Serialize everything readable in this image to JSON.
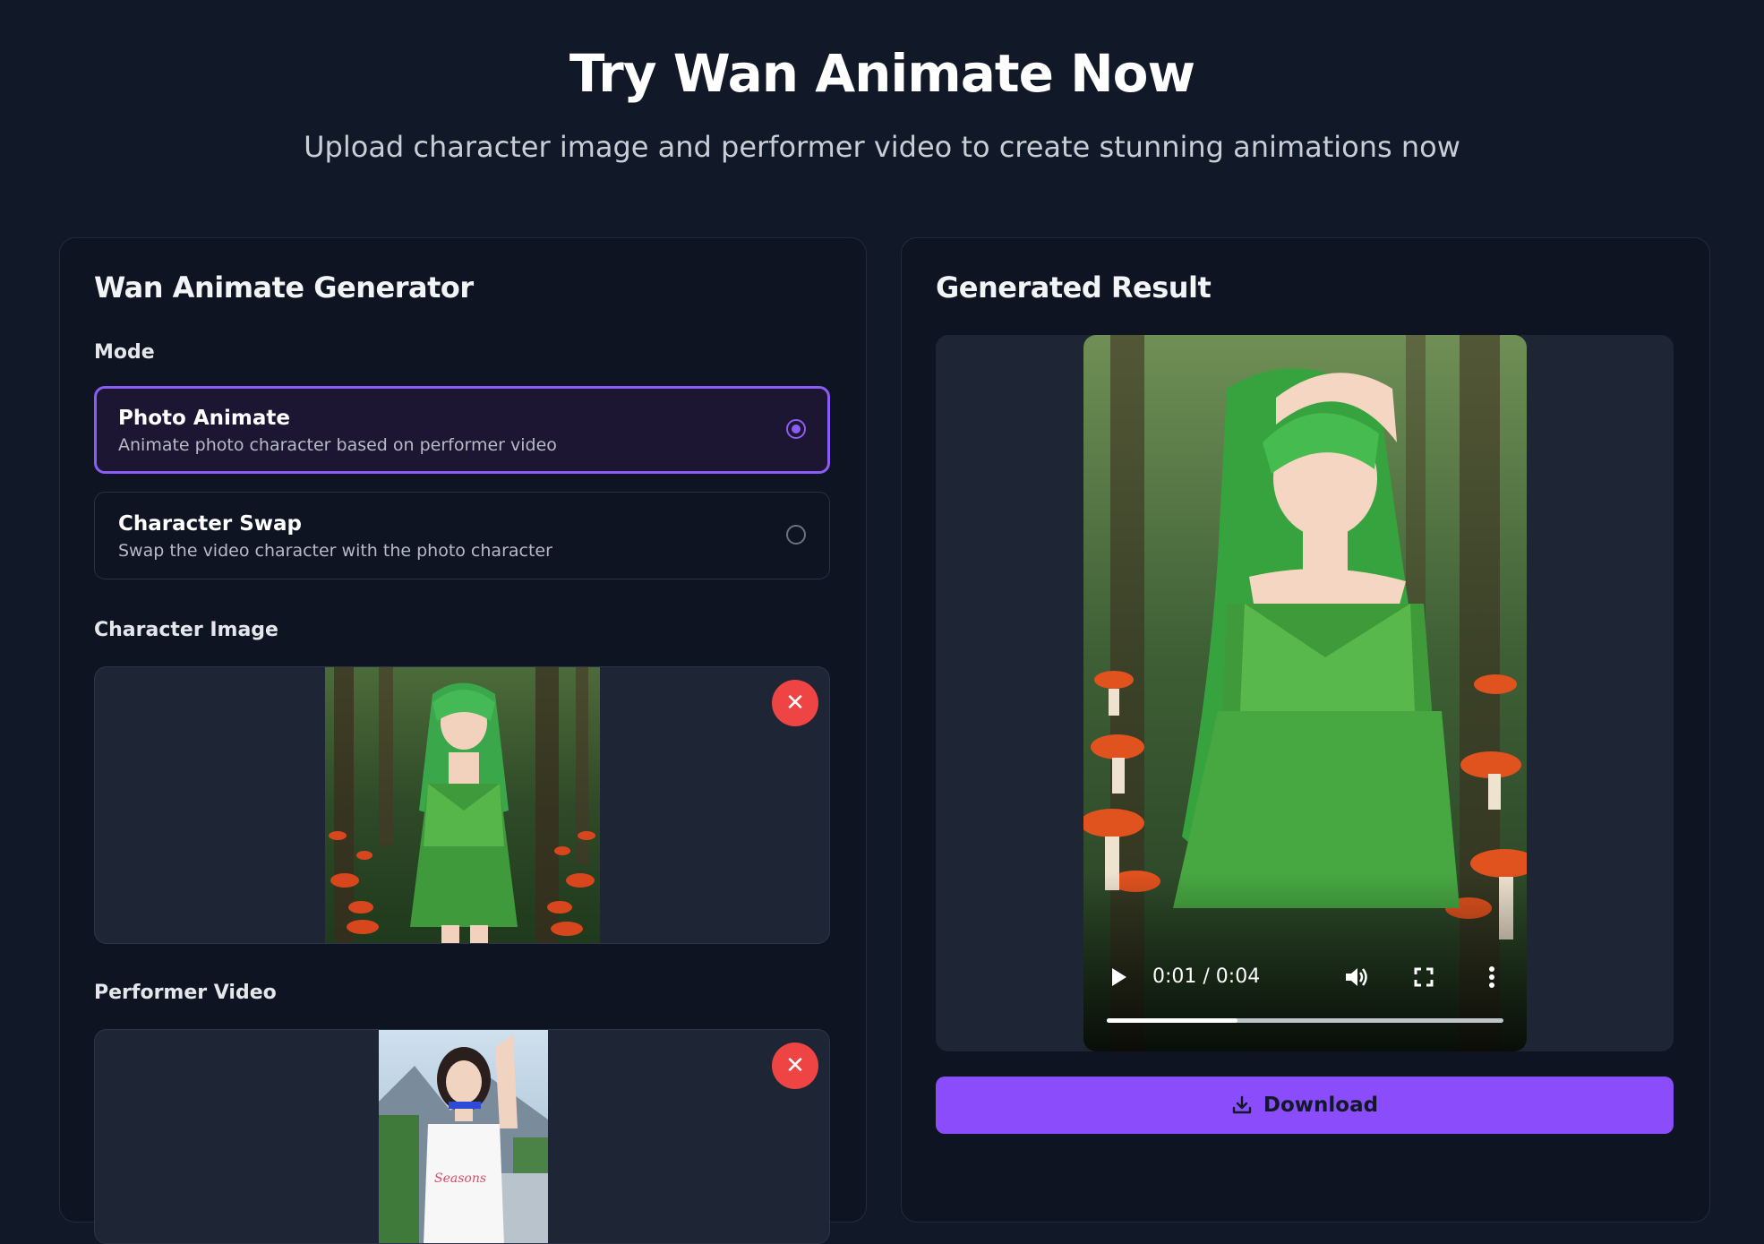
{
  "hero": {
    "title": "Try Wan Animate Now",
    "subtitle": "Upload character image and performer video to create stunning animations now"
  },
  "generator": {
    "title": "Wan Animate Generator",
    "mode_label": "Mode",
    "modes": [
      {
        "title": "Photo Animate",
        "description": "Animate photo character based on performer video",
        "selected": true
      },
      {
        "title": "Character Swap",
        "description": "Swap the video character with the photo character",
        "selected": false
      }
    ],
    "character_image_label": "Character Image",
    "performer_video_label": "Performer Video"
  },
  "result": {
    "title": "Generated Result",
    "video": {
      "time_display": "0:01 / 0:04",
      "progress_fraction": 0.33
    },
    "download_label": "Download"
  },
  "icons": {
    "remove": "close-icon",
    "play": "play-icon",
    "volume": "volume-icon",
    "fullscreen": "fullscreen-icon",
    "more": "more-vertical-icon",
    "download": "download-icon"
  },
  "colors": {
    "background": "#111827",
    "accent": "#8b5cf6",
    "download_button": "#8b4dfc",
    "remove_button": "#ef4444"
  }
}
